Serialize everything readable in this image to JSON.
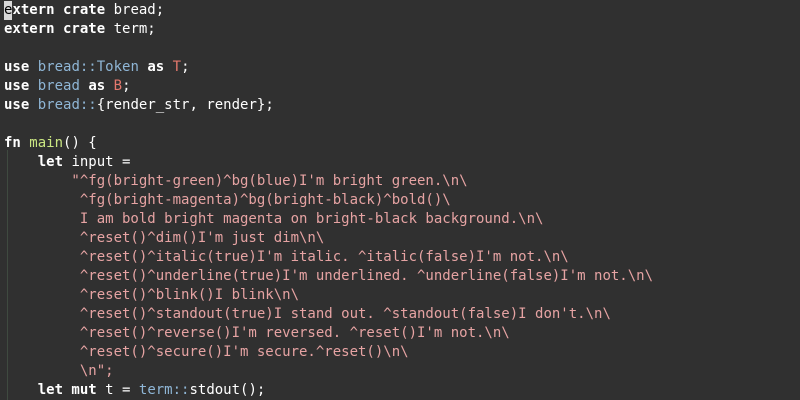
{
  "lines": [
    {
      "segs": [
        {
          "t": "e",
          "c": "cursor"
        },
        {
          "t": "xtern crate",
          "c": "kw"
        },
        {
          "t": " bread;",
          "c": "pl"
        }
      ]
    },
    {
      "segs": [
        {
          "t": "extern crate",
          "c": "kw"
        },
        {
          "t": " term;",
          "c": "pl"
        }
      ]
    },
    {
      "segs": []
    },
    {
      "segs": [
        {
          "t": "use",
          "c": "kw"
        },
        {
          "t": " ",
          "c": "pl"
        },
        {
          "t": "bread::",
          "c": "ns"
        },
        {
          "t": "Token",
          "c": "ns"
        },
        {
          "t": " ",
          "c": "pl"
        },
        {
          "t": "as",
          "c": "kw"
        },
        {
          "t": " ",
          "c": "pl"
        },
        {
          "t": "T",
          "c": "ty"
        },
        {
          "t": ";",
          "c": "pl"
        }
      ]
    },
    {
      "segs": [
        {
          "t": "use",
          "c": "kw"
        },
        {
          "t": " ",
          "c": "pl"
        },
        {
          "t": "bread",
          "c": "ns"
        },
        {
          "t": " ",
          "c": "pl"
        },
        {
          "t": "as",
          "c": "kw"
        },
        {
          "t": " ",
          "c": "pl"
        },
        {
          "t": "B",
          "c": "ty"
        },
        {
          "t": ";",
          "c": "pl"
        }
      ]
    },
    {
      "segs": [
        {
          "t": "use",
          "c": "kw"
        },
        {
          "t": " ",
          "c": "pl"
        },
        {
          "t": "bread::",
          "c": "ns"
        },
        {
          "t": "{render_str, render};",
          "c": "pl"
        }
      ]
    },
    {
      "segs": []
    },
    {
      "segs": [
        {
          "t": "fn",
          "c": "kw"
        },
        {
          "t": " ",
          "c": "pl"
        },
        {
          "t": "main",
          "c": "fn"
        },
        {
          "t": "() {",
          "c": "pl"
        }
      ]
    },
    {
      "segs": [
        {
          "t": "    ",
          "c": "pl"
        },
        {
          "t": "let",
          "c": "kw"
        },
        {
          "t": " input =",
          "c": "pl"
        }
      ]
    },
    {
      "segs": [
        {
          "t": "        \"^fg(bright-green)^bg(blue)I'm bright green.\\n\\",
          "c": "str"
        }
      ]
    },
    {
      "segs": [
        {
          "t": "         ^fg(bright-magenta)^bg(bright-black)^bold()\\",
          "c": "str"
        }
      ]
    },
    {
      "segs": [
        {
          "t": "         I am bold bright magenta on bright-black background.\\n\\",
          "c": "str"
        }
      ]
    },
    {
      "segs": [
        {
          "t": "         ^reset()^dim()I'm just dim\\n\\",
          "c": "str"
        }
      ]
    },
    {
      "segs": [
        {
          "t": "         ^reset()^italic(true)I'm italic. ^italic(false)I'm not.\\n\\",
          "c": "str"
        }
      ]
    },
    {
      "segs": [
        {
          "t": "         ^reset()^underline(true)I'm underlined. ^underline(false)I'm not.\\n\\",
          "c": "str"
        }
      ]
    },
    {
      "segs": [
        {
          "t": "         ^reset()^blink()I blink\\n\\",
          "c": "str"
        }
      ]
    },
    {
      "segs": [
        {
          "t": "         ^reset()^standout(true)I stand out. ^standout(false)I don't.\\n\\",
          "c": "str"
        }
      ]
    },
    {
      "segs": [
        {
          "t": "         ^reset()^reverse()I'm reversed. ^reset()I'm not.\\n\\",
          "c": "str"
        }
      ]
    },
    {
      "segs": [
        {
          "t": "         ^reset()^secure()I'm secure.^reset()\\n\\",
          "c": "str"
        }
      ]
    },
    {
      "segs": [
        {
          "t": "         \\n\";",
          "c": "str"
        }
      ]
    },
    {
      "segs": [
        {
          "t": "    ",
          "c": "pl"
        },
        {
          "t": "let mut",
          "c": "kw"
        },
        {
          "t": " t = ",
          "c": "pl"
        },
        {
          "t": "term::",
          "c": "ns"
        },
        {
          "t": "stdout();",
          "c": "pl"
        }
      ]
    }
  ]
}
